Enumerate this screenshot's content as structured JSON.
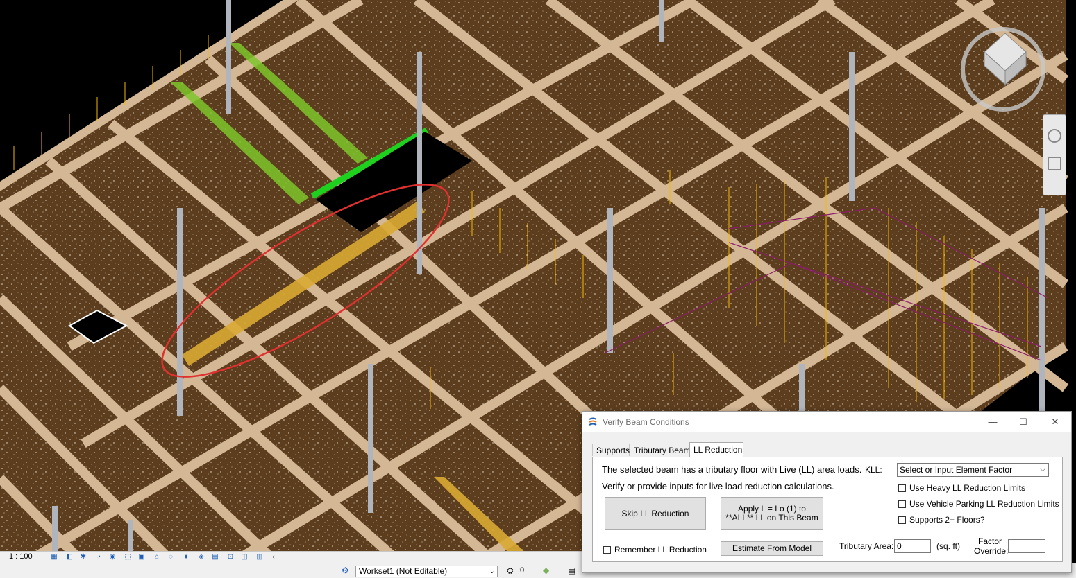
{
  "viewport": {
    "colors": {
      "background": "#000000",
      "slab": "#5c3d1e",
      "beam": "#d4b896",
      "beam_highlight_green": "#7cc52a",
      "beam_selected_green": "#1fd11f",
      "beam_selected_yellow": "#d9a832",
      "load_lines": "#f2b705",
      "area_boundary": "#8b1c6b",
      "selection_ellipse": "#e03030"
    },
    "view_cube_faces": [
      "TOP",
      "LEFT",
      "FRONT"
    ]
  },
  "status_bar": {
    "scale": "1 : 100"
  },
  "bottom_bar": {
    "workset": "Workset1 (Not Editable)",
    "counter": ":0"
  },
  "dialog": {
    "title": "Verify Beam Conditions",
    "window_buttons": {
      "minimize": "—",
      "maximize": "☐",
      "close": "✕"
    },
    "tabs": [
      {
        "label": "Supports"
      },
      {
        "label": "Tributary Beams"
      },
      {
        "label": "LL Reduction"
      }
    ],
    "active_tab": "LL Reduction",
    "message_line1": "The selected beam has a tributary floor with Live (LL) area loads.",
    "message_line2": "Verify or provide inputs for live load reduction calculations.",
    "kll_label": "KLL:",
    "kll_select_value": "Select or Input Element Factor",
    "skip_button": "Skip LL Reduction",
    "apply_button_line1": "Apply L = Lo (1) to",
    "apply_button_line2": "**ALL** LL on This Beam",
    "remember_checkbox": "Remember LL Reduction",
    "estimate_button": "Estimate From Model",
    "tributary_area_label": "Tributary Area:",
    "tributary_area_value": "0",
    "tributary_area_unit": "(sq. ft)",
    "factor_override_line1": "Factor",
    "factor_override_line2": "Override:",
    "factor_override_value": "",
    "options": [
      {
        "label": "Use Heavy LL Reduction Limits",
        "checked": false
      },
      {
        "label": "Use Vehicle Parking LL Reduction Limits",
        "checked": false
      },
      {
        "label": "Supports 2+ Floors?",
        "checked": false
      }
    ]
  }
}
